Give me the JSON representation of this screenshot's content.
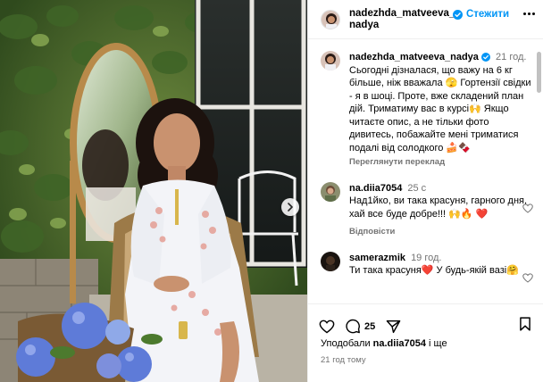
{
  "header": {
    "username": "nadezhda_matveeva_\nnadya",
    "follow_label": "Стежити"
  },
  "caption": {
    "username": "nadezhda_matveeva_nadya",
    "time": "21 год.",
    "text": "Сьогодні дізналася, що важу на 6 кг більше, ніж вважала 🫣 Гортензії свідки - я в шоці. Проте, вже складений план дій. Триматиму вас в курсі🙌 Якщо читаєте опис, а не тільки фото дивитесь, побажайте мені триматися подалі від солодкого 🍰🍫",
    "translate_label": "Переглянути переклад"
  },
  "comments": [
    {
      "username": "na.diia7054",
      "time": "25 с",
      "text": "Над1йко, ви така красуня, гарного дня, хай все буде добре!!! 🙌🔥 ❤️",
      "reply_label": "Відповісти"
    },
    {
      "username": "samerazmik",
      "time": "19 год.",
      "text": "Ти така красуня❤️ У будь-якій вазі🤗"
    }
  ],
  "actions": {
    "comment_count": "25"
  },
  "likes": {
    "prefix": "Уподобали",
    "user": "na.diia7054",
    "suffix": "і ще"
  },
  "posted_ago": "21 год тому",
  "colors": {
    "accent_blue": "#0095f6",
    "muted_text": "#737373",
    "divider": "#efefef",
    "heart_red": "#e0245e"
  },
  "icons": [
    "verified-badge-icon",
    "more-icon",
    "heart-icon",
    "comment-icon",
    "share-icon",
    "bookmark-icon",
    "chevron-right-icon"
  ]
}
